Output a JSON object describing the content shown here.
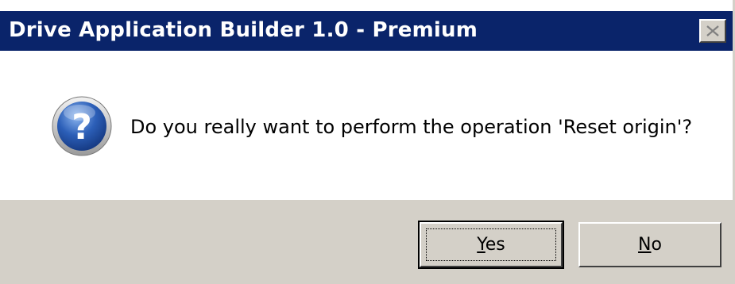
{
  "window": {
    "title": "Drive Application Builder 1.0 - Premium",
    "close_icon": "close-x-icon"
  },
  "message": {
    "icon": "question-icon",
    "text": "Do you really want to perform the operation 'Reset origin'?"
  },
  "buttons": {
    "yes": {
      "accel": "Y",
      "rest": "es"
    },
    "no": {
      "accel": "N",
      "rest": "o"
    }
  },
  "colors": {
    "titlebar": "#0a246a",
    "title_text": "#ffffff",
    "footer": "#d4d0c8",
    "icon_blue": "#2c5fb8"
  }
}
